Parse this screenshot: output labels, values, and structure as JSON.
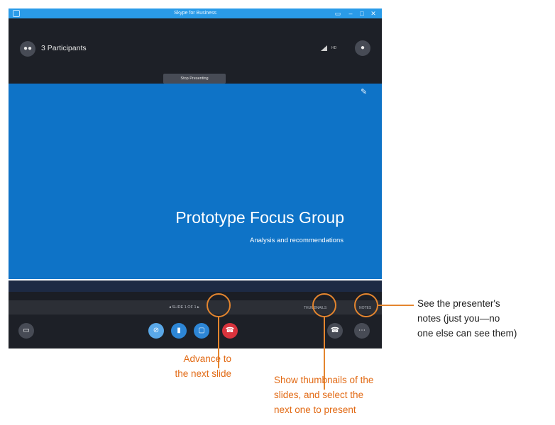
{
  "window": {
    "title": "Skype for Business",
    "controls": [
      "▭",
      "–",
      "□",
      "✕"
    ]
  },
  "meeting": {
    "participants_label": "3 Participants",
    "hd_label": "HD",
    "stop_presenting_label": "Stop Presenting"
  },
  "slide": {
    "title": "Prototype Focus Group",
    "subtitle": "Analysis and recommendations"
  },
  "slide_controls": {
    "prev_arrow": "◂",
    "slide_counter": "SLIDE 1 OF 1",
    "next_arrow": "▸",
    "thumbnails_label": "THUMBNAILS",
    "notes_label": "NOTES"
  },
  "icons": {
    "app": "skype-icon",
    "participants": "people-icon",
    "pen": "pen-icon",
    "chat": "chat-icon",
    "video": "video-off-icon",
    "mic": "mic-icon",
    "present": "present-icon",
    "hangup": "hangup-icon",
    "call_controls": "phone-icon",
    "more": "more-icon"
  },
  "callouts": {
    "next_slide": [
      "Advance to",
      "the next slide"
    ],
    "thumbnails": [
      "Show thumbnails of the",
      "slides, and select the",
      "next one to present"
    ],
    "notes": [
      "See the presenter's",
      "notes (just you—no",
      "one else can see them)"
    ]
  },
  "colors": {
    "accent": "#e4852e",
    "slide_background": "#0e73c7",
    "titlebar": "#2a9be8",
    "hangup": "#d9333d"
  }
}
